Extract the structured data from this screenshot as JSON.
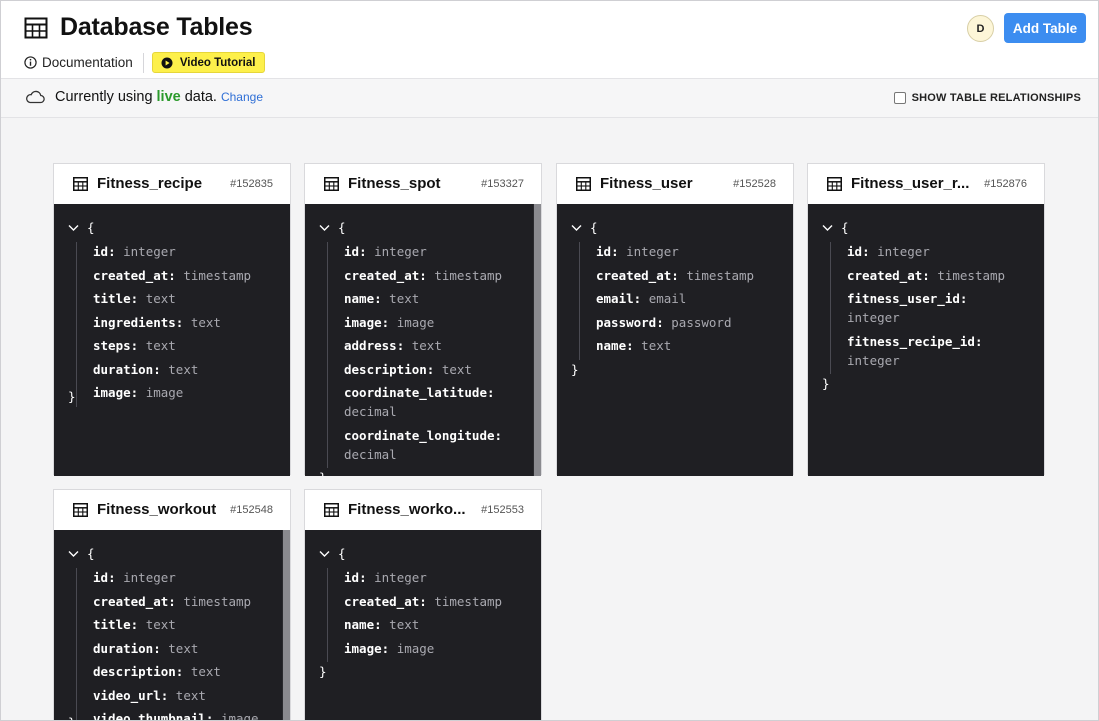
{
  "header": {
    "title": "Database Tables",
    "documentation_label": "Documentation",
    "video_tutorial_label": "Video Tutorial",
    "avatar_initial": "D",
    "add_table_label": "Add Table"
  },
  "status": {
    "prefix": "Currently using",
    "live_word": "live",
    "suffix": "data.",
    "change_label": "Change",
    "relationships_label": "SHOW TABLE RELATIONSHIPS",
    "relationships_checked": false
  },
  "code": {
    "open_brace": "{",
    "close_brace": "}",
    "colon": ":"
  },
  "colors": {
    "accent": "#3c8df0",
    "live": "#2b9a2b",
    "link": "#2f6fd6",
    "code_bg": "#1f1f23",
    "video_bg": "#fdf04b"
  },
  "tables": [
    {
      "name": "Fitness_recipe",
      "id": "#152835",
      "fields": [
        {
          "name": "id",
          "type": "integer"
        },
        {
          "name": "created_at",
          "type": "timestamp"
        },
        {
          "name": "title",
          "type": "text"
        },
        {
          "name": "ingredients",
          "type": "text"
        },
        {
          "name": "steps",
          "type": "text"
        },
        {
          "name": "duration",
          "type": "text"
        },
        {
          "name": "image",
          "type": "image"
        }
      ]
    },
    {
      "name": "Fitness_spot",
      "id": "#153327",
      "fields": [
        {
          "name": "id",
          "type": "integer"
        },
        {
          "name": "created_at",
          "type": "timestamp"
        },
        {
          "name": "name",
          "type": "text"
        },
        {
          "name": "image",
          "type": "image"
        },
        {
          "name": "address",
          "type": "text"
        },
        {
          "name": "description",
          "type": "text"
        },
        {
          "name": "coordinate_latitude",
          "type": "decimal"
        },
        {
          "name": "coordinate_longitude",
          "type": "decimal"
        }
      ]
    },
    {
      "name": "Fitness_user",
      "id": "#152528",
      "fields": [
        {
          "name": "id",
          "type": "integer"
        },
        {
          "name": "created_at",
          "type": "timestamp"
        },
        {
          "name": "email",
          "type": "email"
        },
        {
          "name": "password",
          "type": "password"
        },
        {
          "name": "name",
          "type": "text"
        }
      ]
    },
    {
      "name": "Fitness_user_r...",
      "id": "#152876",
      "fields": [
        {
          "name": "id",
          "type": "integer"
        },
        {
          "name": "created_at",
          "type": "timestamp"
        },
        {
          "name": "fitness_user_id",
          "type": "integer"
        },
        {
          "name": "fitness_recipe_id",
          "type": "integer"
        }
      ]
    },
    {
      "name": "Fitness_workout",
      "id": "#152548",
      "fields": [
        {
          "name": "id",
          "type": "integer"
        },
        {
          "name": "created_at",
          "type": "timestamp"
        },
        {
          "name": "title",
          "type": "text"
        },
        {
          "name": "duration",
          "type": "text"
        },
        {
          "name": "description",
          "type": "text"
        },
        {
          "name": "video_url",
          "type": "text"
        },
        {
          "name": "video_thumbnail",
          "type": "image"
        }
      ]
    },
    {
      "name": "Fitness_worko...",
      "id": "#152553",
      "fields": [
        {
          "name": "id",
          "type": "integer"
        },
        {
          "name": "created_at",
          "type": "timestamp"
        },
        {
          "name": "name",
          "type": "text"
        },
        {
          "name": "image",
          "type": "image"
        }
      ]
    }
  ]
}
